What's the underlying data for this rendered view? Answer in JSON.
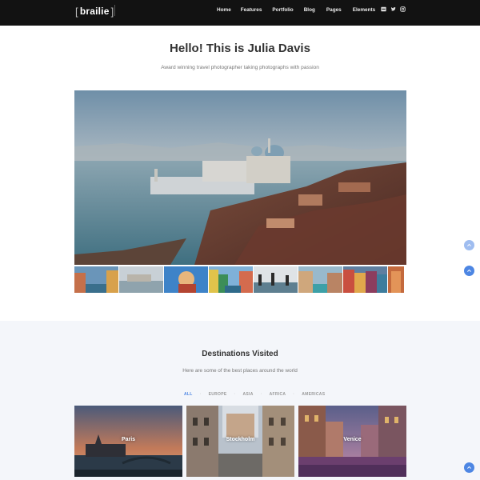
{
  "header": {
    "logo": "brailie",
    "nav": [
      "Home",
      "Features",
      "Portfolio",
      "Blog",
      "Pages",
      "Elements"
    ],
    "social_icons": [
      "square-icon",
      "twitter-icon",
      "instagram-icon"
    ]
  },
  "hero": {
    "title": "Hello! This is Julia Davis",
    "subtitle": "Award winning travel photographer taking photographs with passion"
  },
  "destinations": {
    "title": "Destinations Visited",
    "subtitle": "Here are some of the best places around the world",
    "filters": [
      "ALL",
      "EUROPE",
      "ASIA",
      "AFRICA",
      "AMERICAS"
    ],
    "active_filter": "ALL",
    "cards": [
      {
        "label": "Paris"
      },
      {
        "label": "Stockholm"
      },
      {
        "label": "Venice"
      }
    ]
  },
  "colors": {
    "header_bg": "#121212",
    "accent": "#4d86e3",
    "section_bg": "#f4f6fa"
  }
}
